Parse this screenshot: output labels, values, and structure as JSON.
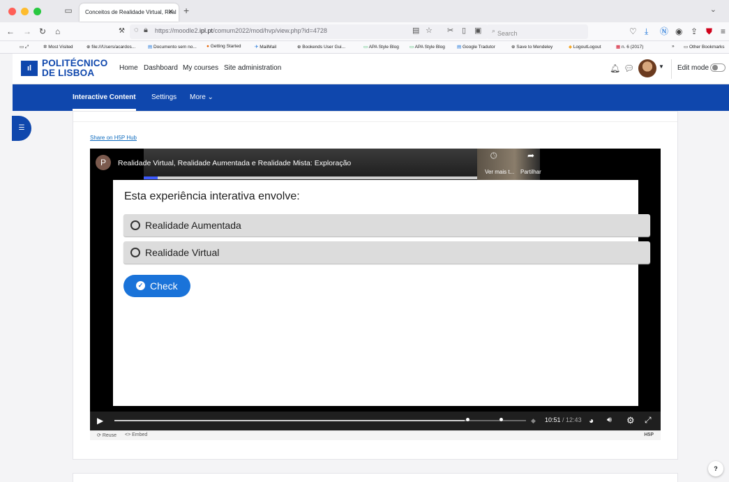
{
  "browser": {
    "tab_title": "Conceitos de Realidade Virtual, Real",
    "tab_close": "✕",
    "new_tab": "+",
    "url_prefix": "https://moodle2.",
    "url_domain": "ipl.pt",
    "url_path": "/comum2022/mod/hvp/view.php?id=4728",
    "search_placeholder": "Search",
    "bookmarks": [
      {
        "label": "Most Visited"
      },
      {
        "label": "file:///Users/acardos..."
      },
      {
        "label": "Documento sem no..."
      },
      {
        "label": "Getting Started"
      },
      {
        "label": "MailMail"
      },
      {
        "label": "Bookends User Gui..."
      },
      {
        "label": "APA Style Blog"
      },
      {
        "label": "APA Style Blog"
      },
      {
        "label": "Google Tradutor"
      },
      {
        "label": "Save to Mendeley"
      },
      {
        "label": "LogoutLogout"
      },
      {
        "label": "n. 6 (2017)"
      },
      {
        "label": "Other Bookmarks"
      }
    ]
  },
  "moodle": {
    "logo_line1": "POLITÉCNICO",
    "logo_line2": "DE LISBOA",
    "nav": [
      "Home",
      "Dashboard",
      "My courses",
      "Site administration"
    ],
    "edit_mode_label": "Edit mode",
    "secondary_nav": {
      "active": "Interactive Content",
      "settings": "Settings",
      "more": "More ⌄"
    }
  },
  "content": {
    "share_link": "Share on H5P Hub",
    "video": {
      "channel_initial": "P",
      "title": "Realidade Virtual, Realidade Aumentada e Realidade Mista: Exploração",
      "watch_later_label": "Ver mais t...",
      "share_label": "Partilhar",
      "current_time": "10:51",
      "duration": "/ 12:43",
      "progress_fraction": 0.85
    },
    "quiz": {
      "question": "Esta experiência interativa envolve:",
      "options": [
        "Realidade Aumentada",
        "Realidade Virtual"
      ],
      "check_label": "Check"
    },
    "footer": {
      "reuse": "Reuse",
      "embed": "Embed",
      "h5p_logo": "H5P"
    }
  },
  "help_label": "?",
  "colors": {
    "brand_blue": "#0f47ad",
    "check_button": "#1a73d9"
  }
}
